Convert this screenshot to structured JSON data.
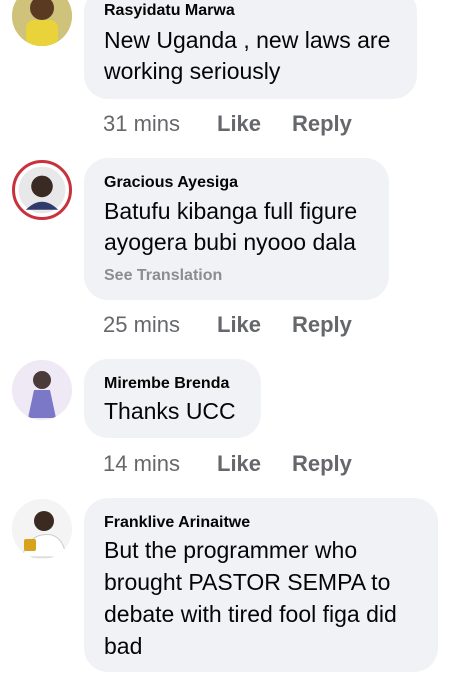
{
  "comments": [
    {
      "author": "Rasyidatu Marwa",
      "lines": [
        "New Uganda , new laws are",
        "working seriously"
      ],
      "time": "31 mins",
      "see_translation": ""
    },
    {
      "author": "Gracious Ayesiga",
      "lines": [
        "Batufu kibanga full figure",
        "ayogera bubi nyooo dala"
      ],
      "time": "25 mins",
      "see_translation": "See Translation"
    },
    {
      "author": "Mirembe Brenda",
      "lines": [
        "Thanks UCC"
      ],
      "time": "14 mins",
      "see_translation": ""
    },
    {
      "author": "Franklive Arinaitwe",
      "lines": [
        "But the programmer who",
        "brought PASTOR SEMPA to",
        "debate with tired fool figa did",
        "bad"
      ],
      "time": "",
      "see_translation": ""
    }
  ],
  "actions": {
    "like_label": "Like",
    "reply_label": "Reply"
  },
  "colors": {
    "bubble_bg": "#f0f2f5",
    "meta_text": "#65676b",
    "translation_text": "#8a8d91",
    "avatar_ring": "#c8323c"
  },
  "icons": {
    "avatar_placeholder": "avatar-photo"
  }
}
